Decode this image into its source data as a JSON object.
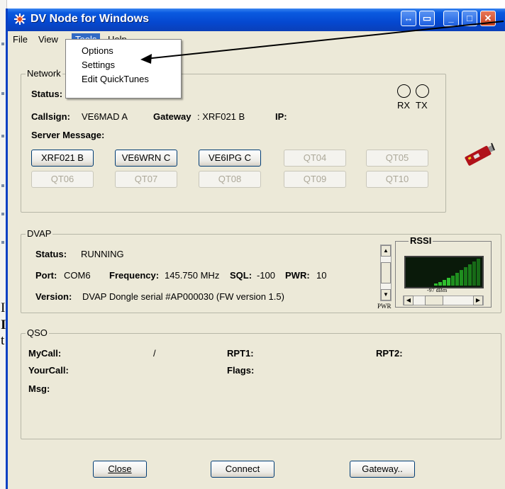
{
  "window": {
    "title": "DV Node for Windows",
    "accent": "#0548d0"
  },
  "background_text": [
    "I",
    "I",
    "t"
  ],
  "menu": {
    "items": [
      "File",
      "View",
      "Tools",
      "Help"
    ],
    "active": "Tools",
    "tools_dropdown": [
      "Options",
      "Settings",
      "Edit QuickTunes"
    ]
  },
  "network": {
    "label": "Network",
    "status_label": "Status:",
    "callsign_label": "Callsign:",
    "callsign": "VE6MAD A",
    "gateway_label": "Gateway",
    "gateway": ": XRF021 B",
    "ip_label": "IP:",
    "server_message_label": "Server Message:",
    "rx_label": "RX",
    "tx_label": "TX",
    "quicktunes": [
      "XRF021 B",
      "VE6WRN C",
      "VE6IPG C",
      "QT04",
      "QT05",
      "QT06",
      "QT07",
      "QT08",
      "QT09",
      "QT10"
    ]
  },
  "dvap": {
    "label": "DVAP",
    "status_label": "Status:",
    "status": "RUNNING",
    "port_label": "Port:",
    "port": "COM6",
    "frequency_label": "Frequency:",
    "frequency": "145.750 MHz",
    "sql_label": "SQL:",
    "sql": "-100",
    "pwr_label": "PWR:",
    "pwr": "10",
    "version_label": "Version:",
    "version": "DVAP Dongle serial #AP000030 (FW version 1.5)",
    "pwr_slider_label": "PWR",
    "rssi_label": "RSSI",
    "rssi_value": "-97 dBm"
  },
  "qso": {
    "label": "QSO",
    "mycall_label": "MyCall:",
    "mycall_sep": "/",
    "rpt1_label": "RPT1:",
    "rpt2_label": "RPT2:",
    "yourcall_label": "YourCall:",
    "flags_label": "Flags:",
    "msg_label": "Msg:"
  },
  "buttons": {
    "close": "Close",
    "connect": "Connect",
    "gateway": "Gateway.."
  }
}
